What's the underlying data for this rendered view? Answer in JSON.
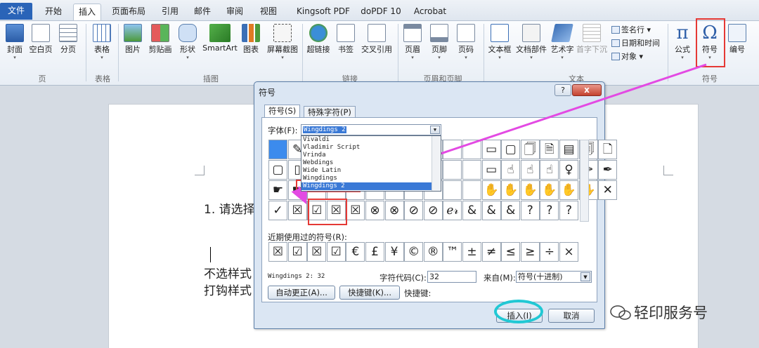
{
  "tabs": [
    {
      "label": "文件"
    },
    {
      "label": "开始"
    },
    {
      "label": "插入"
    },
    {
      "label": "页面布局"
    },
    {
      "label": "引用"
    },
    {
      "label": "邮件"
    },
    {
      "label": "审阅"
    },
    {
      "label": "视图"
    },
    {
      "label": "Kingsoft PDF"
    },
    {
      "label": "doPDF 10"
    },
    {
      "label": "Acrobat"
    }
  ],
  "ribbon": {
    "buttons": [
      {
        "label": "封面"
      },
      {
        "label": "空白页"
      },
      {
        "label": "分页"
      },
      {
        "label": "表格"
      },
      {
        "label": "图片"
      },
      {
        "label": "剪贴画"
      },
      {
        "label": "形状"
      },
      {
        "label": "SmartArt"
      },
      {
        "label": "图表"
      },
      {
        "label": "屏幕截图"
      },
      {
        "label": "超链接"
      },
      {
        "label": "书签"
      },
      {
        "label": "交叉引用"
      },
      {
        "label": "页眉"
      },
      {
        "label": "页脚"
      },
      {
        "label": "页码"
      },
      {
        "label": "文本框"
      },
      {
        "label": "文档部件"
      },
      {
        "label": "艺术字"
      },
      {
        "label": "首字下沉"
      },
      {
        "label": "公式"
      },
      {
        "label": "符号"
      },
      {
        "label": "编号"
      }
    ],
    "small": {
      "signature": "签名行",
      "datetime": "日期和时间",
      "object": "对象"
    },
    "groups": [
      "页",
      "表格",
      "插图",
      "链接",
      "页眉和页脚",
      "文本",
      "符号"
    ]
  },
  "document": {
    "line1": "1. 请选择",
    "line2": "不选样式",
    "line3": "打钩样式"
  },
  "dialog": {
    "title": "符号",
    "help": "?",
    "close": "x",
    "tab_symbols": "符号(S)",
    "tab_special": "特殊字符(P)",
    "font_label": "字体(F):",
    "font_value": "Wingdings 2",
    "font_list": [
      "Vivaldi",
      "Vladimir Script",
      "Vrinda",
      "Webdings",
      "Wide Latin",
      "Wingdings",
      "Wingdings 2"
    ],
    "grid_rows": [
      [
        "",
        "✎",
        "",
        "",
        "",
        "",
        "",
        "",
        "",
        "",
        "",
        "▭",
        "▢",
        "🗍",
        "🗎",
        "▤",
        "🗐",
        "🗋"
      ],
      [
        "▢",
        "▯",
        "",
        "",
        "",
        "",
        "",
        "",
        "",
        "",
        "",
        "▭",
        "☝",
        "☝",
        "☝",
        "♀",
        "✑",
        "✒"
      ],
      [
        "☛",
        "☛",
        "",
        "",
        "",
        "",
        "",
        "",
        "",
        "",
        "",
        "✋",
        "✋",
        "✋",
        "✋",
        "✋",
        "✋",
        "✕"
      ],
      [
        "✓",
        "☒",
        "☑",
        "☒",
        "☒",
        "⊗",
        "⊗",
        "⊘",
        "⊘",
        "ℯ𝓇",
        "&",
        "&",
        "&",
        "?",
        "?",
        "?"
      ]
    ],
    "recent_label": "近期使用过的符号(R):",
    "recent": [
      "☒",
      "☑",
      "☒",
      "☑",
      "€",
      "£",
      "¥",
      "©",
      "®",
      "™",
      "±",
      "≠",
      "≤",
      "≥",
      "÷",
      "×"
    ],
    "char_name": "Wingdings 2: 32",
    "code_label": "字符代码(C):",
    "code_value": "32",
    "from_label": "来自(M):",
    "from_value": "符号(十进制)",
    "autocorrect": "自动更正(A)...",
    "shortcut_btn": "快捷键(K)...",
    "shortcut_label": "快捷键:",
    "insert": "插入(I)",
    "cancel": "取消"
  },
  "watermark": "轻印服务号",
  "colors": {
    "accent": "#2a64b8",
    "highlight": "#e53935",
    "arrow": "#e34ae3",
    "ring": "#21c8d4"
  }
}
